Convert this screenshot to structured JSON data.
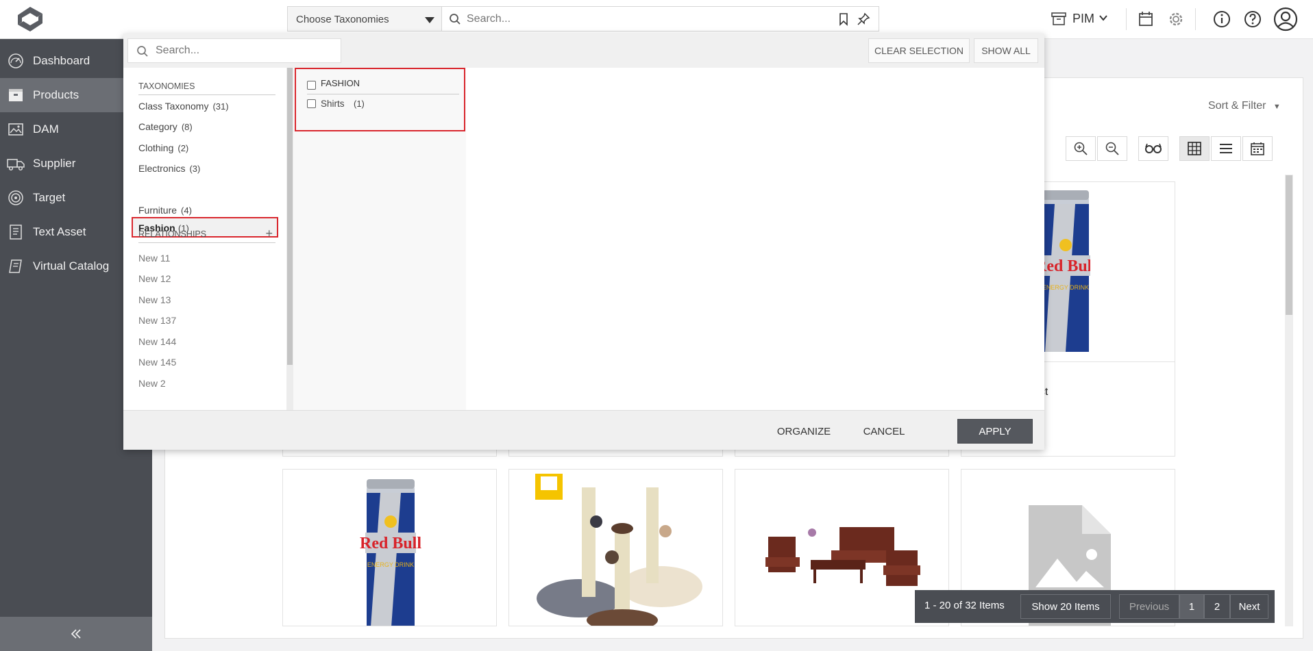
{
  "topbar": {
    "taxonomy_select": "Choose Taxonomies",
    "search_placeholder": "Search...",
    "app_switch": "PIM"
  },
  "sidebar": {
    "items": [
      {
        "label": "Dashboard",
        "icon": "dashboard-gauge-icon"
      },
      {
        "label": "Products",
        "icon": "products-box-icon",
        "active": true
      },
      {
        "label": "DAM",
        "icon": "image-icon"
      },
      {
        "label": "Supplier",
        "icon": "truck-icon"
      },
      {
        "label": "Target",
        "icon": "target-icon"
      },
      {
        "label": "Text Asset",
        "icon": "document-icon"
      },
      {
        "label": "Virtual Catalog",
        "icon": "catalog-icon"
      }
    ]
  },
  "main": {
    "sort_filter": "Sort & Filter",
    "card_partial_title": "uct",
    "pager": {
      "range": "1 - 20 of 32 Items",
      "show": "Show 20 Items",
      "prev": "Previous",
      "page1": "1",
      "page2": "2",
      "next": "Next"
    }
  },
  "dialog": {
    "search_placeholder": "Search...",
    "clear_selection": "CLEAR SELECTION",
    "show_all": "SHOW ALL",
    "taxonomies_header": "TAXONOMIES",
    "taxonomies": [
      {
        "label": "Class Taxonomy",
        "count": "(31)"
      },
      {
        "label": "Category",
        "count": "(8)"
      },
      {
        "label": "Clothing",
        "count": "(2)"
      },
      {
        "label": "Electronics",
        "count": "(3)"
      },
      {
        "label": "Fashion",
        "count": "(1)",
        "selected": true
      },
      {
        "label": "Furniture",
        "count": "(4)"
      }
    ],
    "relationships_header": "RELATIONSHIPS",
    "relationships": [
      "New 11",
      "New 12",
      "New 13",
      "New 137",
      "New 144",
      "New 145",
      "New 2"
    ],
    "tree": {
      "root": "FASHION",
      "child": "Shirts",
      "child_count": "(1)"
    },
    "organize": "ORGANIZE",
    "cancel": "CANCEL",
    "apply": "APPLY"
  },
  "colors": {
    "sidebar_bg": "#4a4d53",
    "sidebar_active": "#6b6e74",
    "highlight_red": "#d9262d",
    "apply_bg": "#55585e"
  }
}
